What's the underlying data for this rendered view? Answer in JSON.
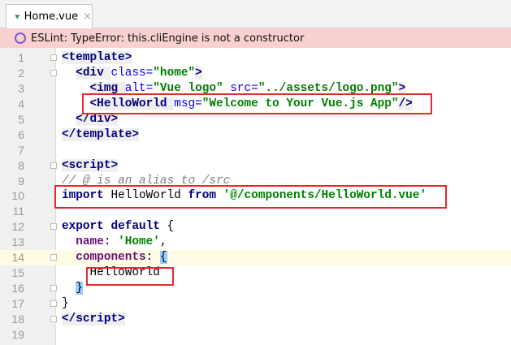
{
  "tab": {
    "label": "Home.vue",
    "close": "×",
    "icon": "vue-logo-icon"
  },
  "error": {
    "text": "ESLint: TypeError: this.cliEngine is not a constructor"
  },
  "lines": [
    {
      "n": "1",
      "t": [
        [
          "<template>",
          "tag"
        ]
      ]
    },
    {
      "n": "2",
      "t": [
        [
          "  ",
          "pl"
        ],
        [
          "<div ",
          "tag"
        ],
        [
          "class=",
          "attr"
        ],
        [
          "\"home\"",
          "str"
        ],
        [
          ">",
          "tag"
        ]
      ]
    },
    {
      "n": "3",
      "t": [
        [
          "    ",
          "pl"
        ],
        [
          "<img ",
          "tag"
        ],
        [
          "alt=",
          "attr"
        ],
        [
          "\"Vue logo\" ",
          "str"
        ],
        [
          "src=",
          "attr"
        ],
        [
          "\"../assets/logo.png\"",
          "str"
        ],
        [
          ">",
          "tag"
        ]
      ]
    },
    {
      "n": "4",
      "t": [
        [
          "    ",
          "pl"
        ],
        [
          "<HelloWorld ",
          "tag"
        ],
        [
          "msg=",
          "attr"
        ],
        [
          "\"Welcome to Your Vue.js App\"",
          "str"
        ],
        [
          "/>",
          "tag"
        ]
      ]
    },
    {
      "n": "5",
      "t": [
        [
          "  ",
          "pl"
        ],
        [
          "</div>",
          "tag"
        ]
      ]
    },
    {
      "n": "6",
      "t": [
        [
          "</template>",
          "tag"
        ]
      ]
    },
    {
      "n": "7",
      "t": []
    },
    {
      "n": "8",
      "t": [
        [
          "<script>",
          "tag"
        ]
      ]
    },
    {
      "n": "9",
      "t": [
        [
          "// @ is an alias to /src",
          "cmt"
        ]
      ]
    },
    {
      "n": "10",
      "t": [
        [
          "import ",
          "kw"
        ],
        [
          "HelloWorld ",
          "pl"
        ],
        [
          "from ",
          "kw"
        ],
        [
          "'@/components/HelloWorld.vue'",
          "str"
        ]
      ]
    },
    {
      "n": "11",
      "t": []
    },
    {
      "n": "12",
      "t": [
        [
          "export default ",
          "kw"
        ],
        [
          "{",
          "pl"
        ]
      ]
    },
    {
      "n": "13",
      "t": [
        [
          "  ",
          "pl"
        ],
        [
          "name",
          "prop"
        ],
        [
          ": ",
          "pl"
        ],
        [
          "'Home'",
          "str"
        ],
        [
          ",",
          "pl"
        ]
      ]
    },
    {
      "n": "14",
      "t": [
        [
          "  ",
          "pl"
        ],
        [
          "components",
          "prop"
        ],
        [
          ": ",
          "pl"
        ],
        [
          "{",
          "br"
        ]
      ]
    },
    {
      "n": "15",
      "t": [
        [
          "    HelloWorld",
          "pl"
        ]
      ]
    },
    {
      "n": "16",
      "t": [
        [
          "  ",
          "pl"
        ],
        [
          "}",
          "br"
        ]
      ]
    },
    {
      "n": "17",
      "t": [
        [
          "}",
          "pl"
        ]
      ]
    },
    {
      "n": "18",
      "t": [
        [
          "</script>",
          "tag"
        ]
      ]
    },
    {
      "n": "19",
      "t": []
    }
  ]
}
